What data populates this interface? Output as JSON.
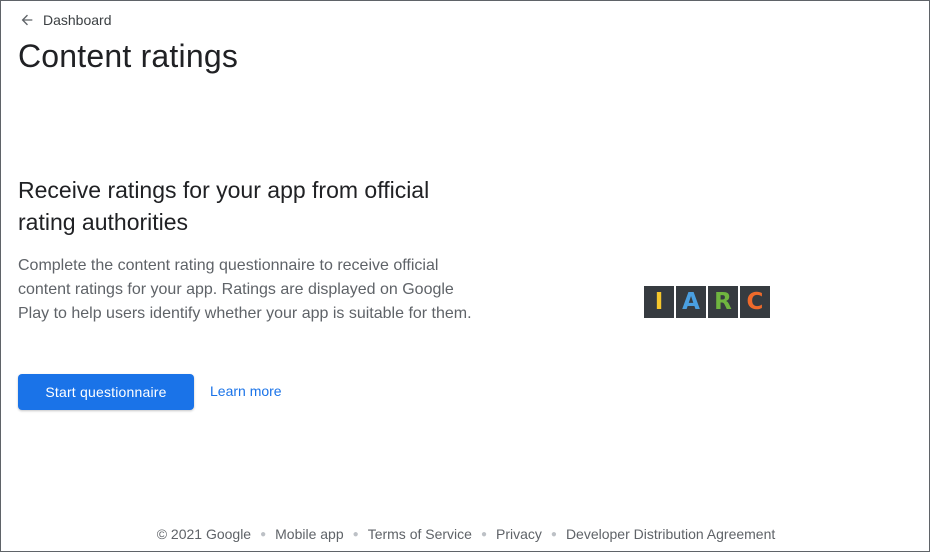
{
  "nav": {
    "back_label": "Dashboard"
  },
  "page": {
    "title": "Content ratings"
  },
  "hero": {
    "heading": "Receive ratings for your app from official rating authorities",
    "body": "Complete the content rating questionnaire to receive official content ratings for your app. Ratings are displayed on Google Play to help users identify whether your app is suitable for them.",
    "primary_button": "Start questionnaire",
    "secondary_link": "Learn more"
  },
  "logo": {
    "letters": [
      "I",
      "A",
      "R",
      "C"
    ],
    "colors": [
      "#f6c72c",
      "#4a9fe0",
      "#6fb53f",
      "#ef6a2b"
    ]
  },
  "footer": {
    "copyright": "© 2021 Google",
    "links": [
      "Mobile app",
      "Terms of Service",
      "Privacy",
      "Developer Distribution Agreement"
    ]
  },
  "colors": {
    "accent": "#1a73e8",
    "text": "#202124",
    "muted": "#5f6368"
  }
}
